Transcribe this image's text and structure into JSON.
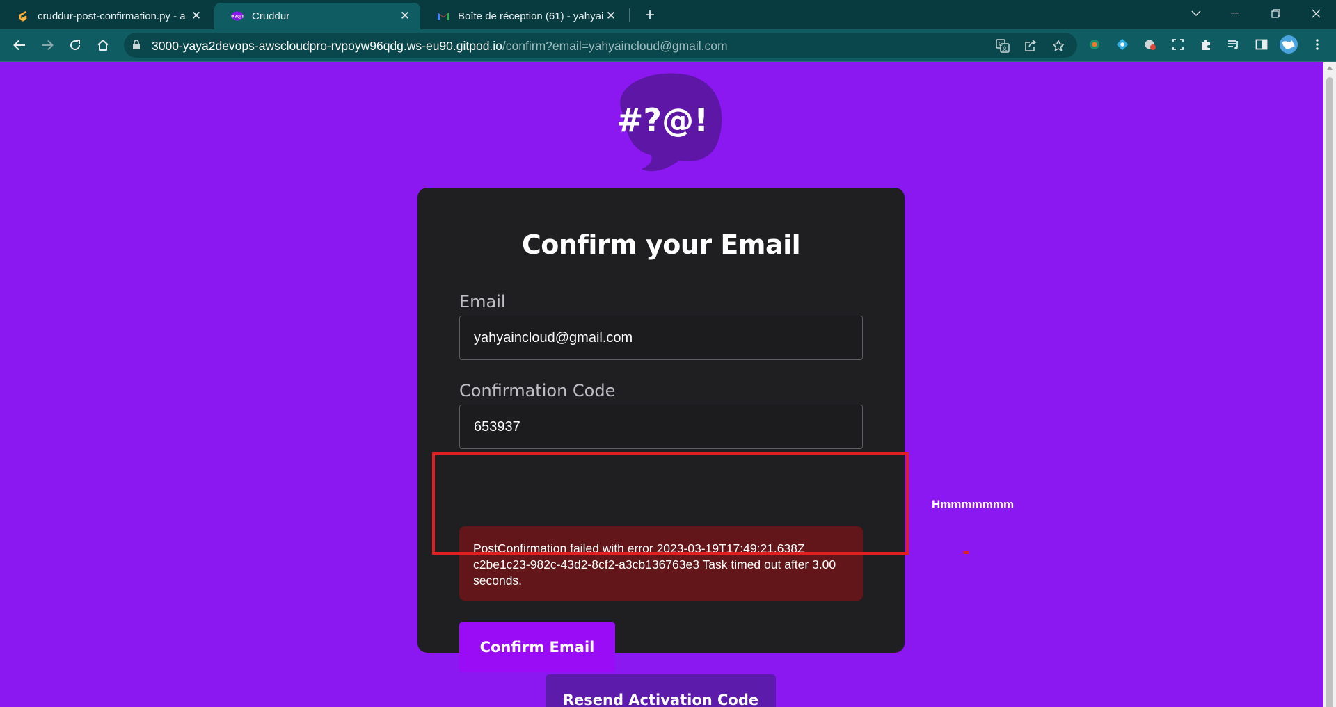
{
  "browser": {
    "tabs": [
      {
        "title": "cruddur-post-confirmation.py - a",
        "favicon": "gitpod-icon",
        "close": "✕"
      },
      {
        "title": "Cruddur",
        "favicon": "cruddur-icon",
        "close": "✕"
      },
      {
        "title": "Boîte de réception (61) - yahyain",
        "favicon": "gmail-icon",
        "close": "✕"
      }
    ],
    "new_tab": "+",
    "address_bar": {
      "host": "3000-yaya2devops-awscloudpro-rvpoyw96qdg.ws-eu90.gitpod.io",
      "path": "/confirm?email=yahyaincloud@gmail.com"
    },
    "colors": {
      "tabbar": "#073b40",
      "toolbar": "#0f5d62"
    }
  },
  "page": {
    "logo_text": "#?@!",
    "heading": "Confirm your Email",
    "email_label": "Email",
    "email_value": "yahyaincloud@gmail.com",
    "code_label": "Confirmation Code",
    "code_value": "653937",
    "error_message": "PostConfirmation failed with error 2023-03-19T17:49:21.638Z c2be1c23-982c-43d2-8cf2-a3cb136763e3 Task timed out after 3.00 seconds.",
    "confirm_button": "Confirm Email",
    "resend_button": "Resend Activation Code",
    "colors": {
      "background": "#8b18f0",
      "card": "#1f1f21",
      "error": "#621619",
      "button": "#9a0cf5"
    }
  },
  "annotation": {
    "text": "Hmmmmmmm",
    "color": "#e02020"
  }
}
